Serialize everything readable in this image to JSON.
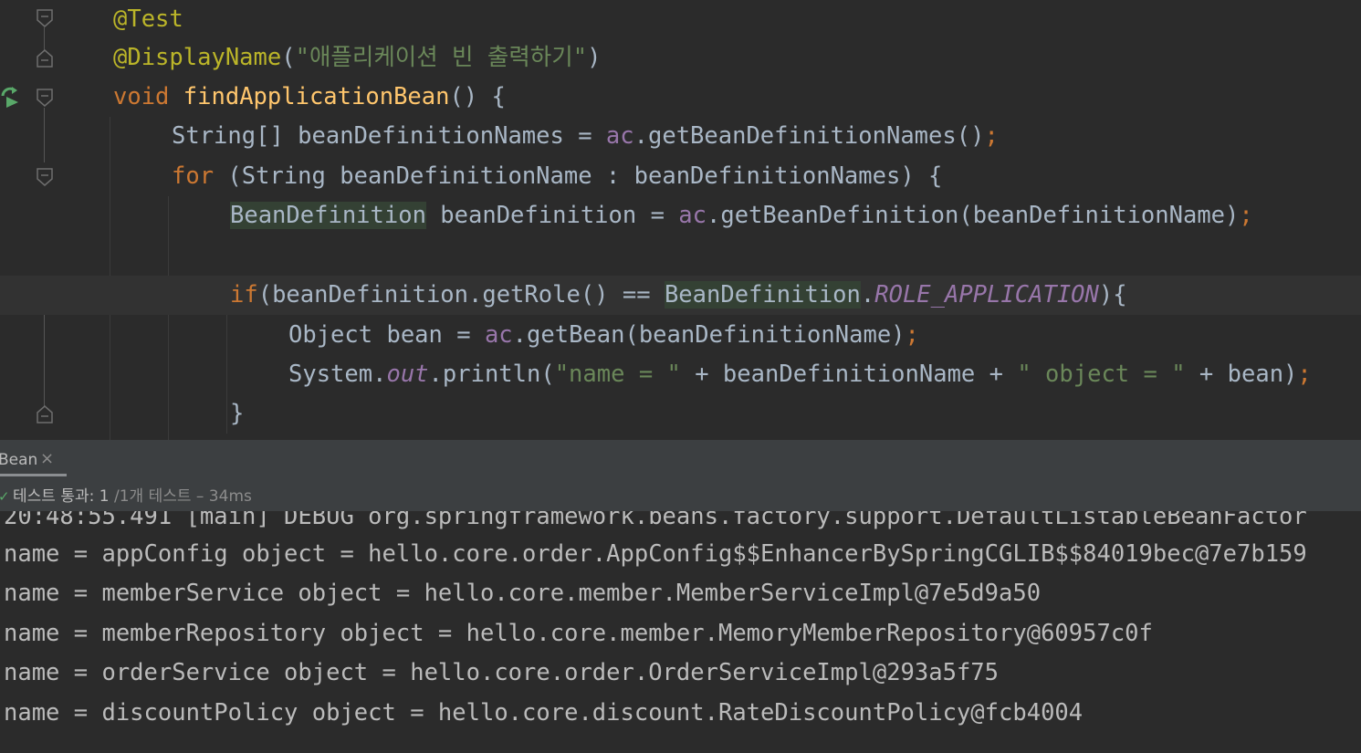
{
  "editor": {
    "lines": [
      {
        "text": "@Test"
      },
      {
        "ann": "@DisplayName",
        "paren_open": "(",
        "str": "\"애플리케이션 빈 출력하기\"",
        "paren_close": ")"
      },
      {
        "kw": "void",
        "fn": "findApplicationBean",
        "rest": "() {"
      },
      {
        "text": "String[] beanDefinitionNames = ",
        "field": "ac",
        "rest": ".getBeanDefinitionNames()",
        "semi": ";"
      },
      {
        "kw": "for",
        "rest": " (String beanDefinitionName : beanDefinitionNames) {"
      },
      {
        "hl": "BeanDefinition",
        "text": " beanDefinition = ",
        "field": "ac",
        "rest": ".getBeanDefinition(beanDefinitionName)",
        "semi": ";"
      },
      {
        "kw": "if",
        "text": "(beanDefinition.getRole() == ",
        "hl": "BeanDefinition",
        "dot": ".",
        "const": "ROLE_APPLICATION",
        "rest": "){"
      },
      {
        "text": "Object bean = ",
        "field": "ac",
        "rest": ".getBean(beanDefinitionName)",
        "semi": ";"
      },
      {
        "text": "System.",
        "out": "out",
        "mid": ".println(",
        "s1": "\"name = \"",
        "mid2": " + beanDefinitionName + ",
        "s2": "\" object = \"",
        "end": " + bean)",
        "semi": ";"
      },
      {
        "text": "}"
      }
    ]
  },
  "panel": {
    "tab_label": "Bean",
    "tab_close": "×",
    "status": {
      "check": "✓",
      "label": "테스트 통과:",
      "passed": "1",
      "total": "/1개 테스트",
      "time": "– 34ms"
    }
  },
  "console": {
    "partial_line": "20:48:55.491 [main] DEBUG org.springframework.beans.factory.support.DefaultListableBeanFactor",
    "lines": [
      "name = appConfig object = hello.core.order.AppConfig$$EnhancerBySpringCGLIB$$84019bec@7e7b159",
      "name = memberService object = hello.core.member.MemberServiceImpl@7e5d9a50",
      "name = memberRepository object = hello.core.member.MemoryMemberRepository@60957c0f",
      "name = orderService object = hello.core.order.OrderServiceImpl@293a5f75",
      "name = discountPolicy object = hello.core.discount.RateDiscountPolicy@fcb4004"
    ]
  },
  "colors": {
    "background": "#2b2b2b",
    "keyword": "#cc7832",
    "annotation": "#bbb529",
    "function": "#ffc66d",
    "string": "#6a8759",
    "field": "#9876aa",
    "text": "#a9b7c6",
    "run_icon": "#59a869",
    "bulb": "#f0c43c"
  },
  "icons": [
    "run-test-icon",
    "lightbulb-icon",
    "fold-icon",
    "check-icon",
    "close-icon"
  ]
}
